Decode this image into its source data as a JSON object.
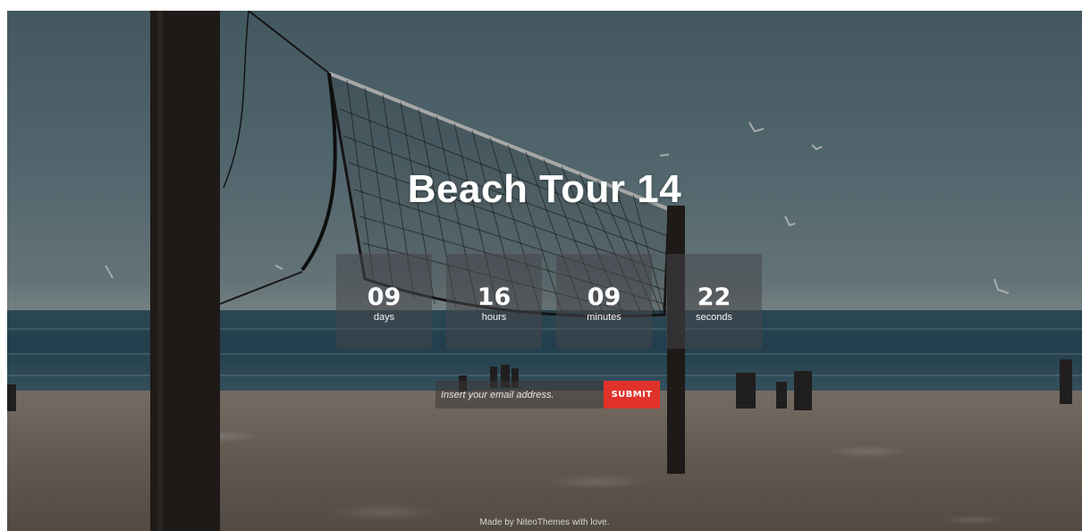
{
  "page": {
    "title": "Beach Tour 14"
  },
  "countdown": [
    {
      "value": "09",
      "unit": "days"
    },
    {
      "value": "16",
      "unit": "hours"
    },
    {
      "value": "09",
      "unit": "minutes"
    },
    {
      "value": "22",
      "unit": "seconds"
    }
  ],
  "subscribe": {
    "placeholder": "Insert your email address.",
    "submit_label": "SUBMIT",
    "submit_color": "#e0322a"
  },
  "footer": {
    "text": "Made by NiteoThemes with love."
  }
}
